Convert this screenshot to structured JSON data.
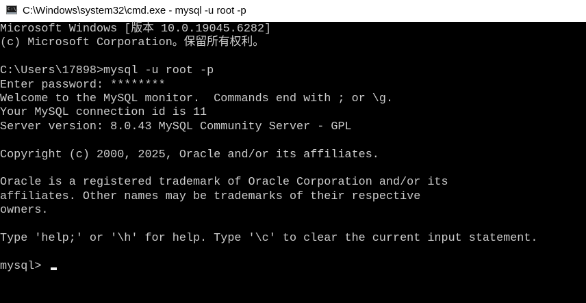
{
  "window": {
    "title": "C:\\Windows\\system32\\cmd.exe - mysql  -u root -p",
    "icon": "cmd-console-icon",
    "icon_glyph": "C:\\."
  },
  "console": {
    "lines": [
      "Microsoft Windows [版本 10.0.19045.6282]",
      "(c) Microsoft Corporation。保留所有权利。",
      "",
      "C:\\Users\\17898>mysql -u root -p",
      "Enter password: ********",
      "Welcome to the MySQL monitor.  Commands end with ; or \\g.",
      "Your MySQL connection id is 11",
      "Server version: 8.0.43 MySQL Community Server - GPL",
      "",
      "Copyright (c) 2000, 2025, Oracle and/or its affiliates.",
      "",
      "Oracle is a registered trademark of Oracle Corporation and/or its",
      "affiliates. Other names may be trademarks of their respective",
      "owners.",
      "",
      "Type 'help;' or '\\h' for help. Type '\\c' to clear the current input statement.",
      ""
    ],
    "prompt": "mysql> ",
    "text_color": "#cccccc",
    "background_color": "#000000"
  }
}
